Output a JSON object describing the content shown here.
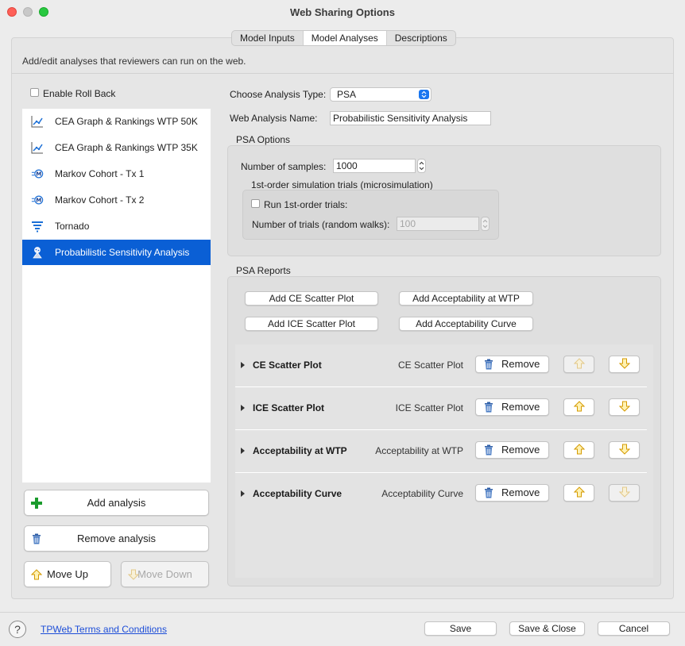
{
  "window": {
    "title": "Web Sharing Options"
  },
  "tabs": [
    {
      "label": "Model Inputs",
      "active": false
    },
    {
      "label": "Model Analyses",
      "active": true
    },
    {
      "label": "Descriptions",
      "active": false
    }
  ],
  "description": "Add/edit analyses that reviewers can run on the web.",
  "sidebar": {
    "enable_rollback_label": "Enable Roll Back",
    "enable_rollback_checked": false,
    "items": [
      {
        "label": "CEA Graph & Rankings WTP 50K",
        "icon": "chart-line-icon",
        "selected": false
      },
      {
        "label": "CEA Graph & Rankings WTP 35K",
        "icon": "chart-line-icon",
        "selected": false
      },
      {
        "label": "Markov Cohort - Tx 1",
        "icon": "markov-node-icon",
        "selected": false
      },
      {
        "label": "Markov Cohort - Tx 2",
        "icon": "markov-node-icon",
        "selected": false
      },
      {
        "label": "Tornado",
        "icon": "tornado-icon",
        "selected": false
      },
      {
        "label": "Probabilistic Sensitivity Analysis",
        "icon": "psa-dice-icon",
        "selected": true
      }
    ],
    "add_label": "Add analysis",
    "remove_label": "Remove analysis",
    "move_up_label": "Move Up",
    "move_down_label": "Move Down"
  },
  "form": {
    "type_label": "Choose Analysis Type:",
    "type_value": "PSA",
    "name_label": "Web Analysis Name:",
    "name_value": "Probabilistic Sensitivity Analysis"
  },
  "psa_options": {
    "title": "PSA Options",
    "samples_label": "Number of samples:",
    "samples_value": "1000",
    "first_order_title": "1st-order simulation trials (microsimulation)",
    "run_first_order_label": "Run 1st-order trials:",
    "run_first_order_checked": false,
    "trials_label": "Number of trials (random walks):",
    "trials_value": "100"
  },
  "psa_reports": {
    "title": "PSA Reports",
    "add_ce_label": "Add CE Scatter Plot",
    "add_accept_wtp_label": "Add Acceptability at WTP",
    "add_ice_label": "Add ICE Scatter Plot",
    "add_accept_curve_label": "Add Acceptability Curve",
    "remove_label": "Remove",
    "rows": [
      {
        "name": "CE Scatter Plot",
        "type": "CE Scatter Plot",
        "up_enabled": false,
        "down_enabled": true
      },
      {
        "name": "ICE Scatter Plot",
        "type": "ICE Scatter Plot",
        "up_enabled": true,
        "down_enabled": true
      },
      {
        "name": "Acceptability at WTP",
        "type": "Acceptability at WTP",
        "up_enabled": true,
        "down_enabled": true
      },
      {
        "name": "Acceptability Curve",
        "type": "Acceptability Curve",
        "up_enabled": true,
        "down_enabled": false
      }
    ]
  },
  "footer": {
    "help_symbol": "?",
    "terms_label": "TPWeb Terms and Conditions",
    "save_label": "Save",
    "save_close_label": "Save & Close",
    "cancel_label": "Cancel"
  },
  "colors": {
    "selection": "#0a5fd5",
    "link": "#1d4ed8",
    "add_green": "#1a9b2c",
    "arrow_amber": "#e3a300"
  }
}
